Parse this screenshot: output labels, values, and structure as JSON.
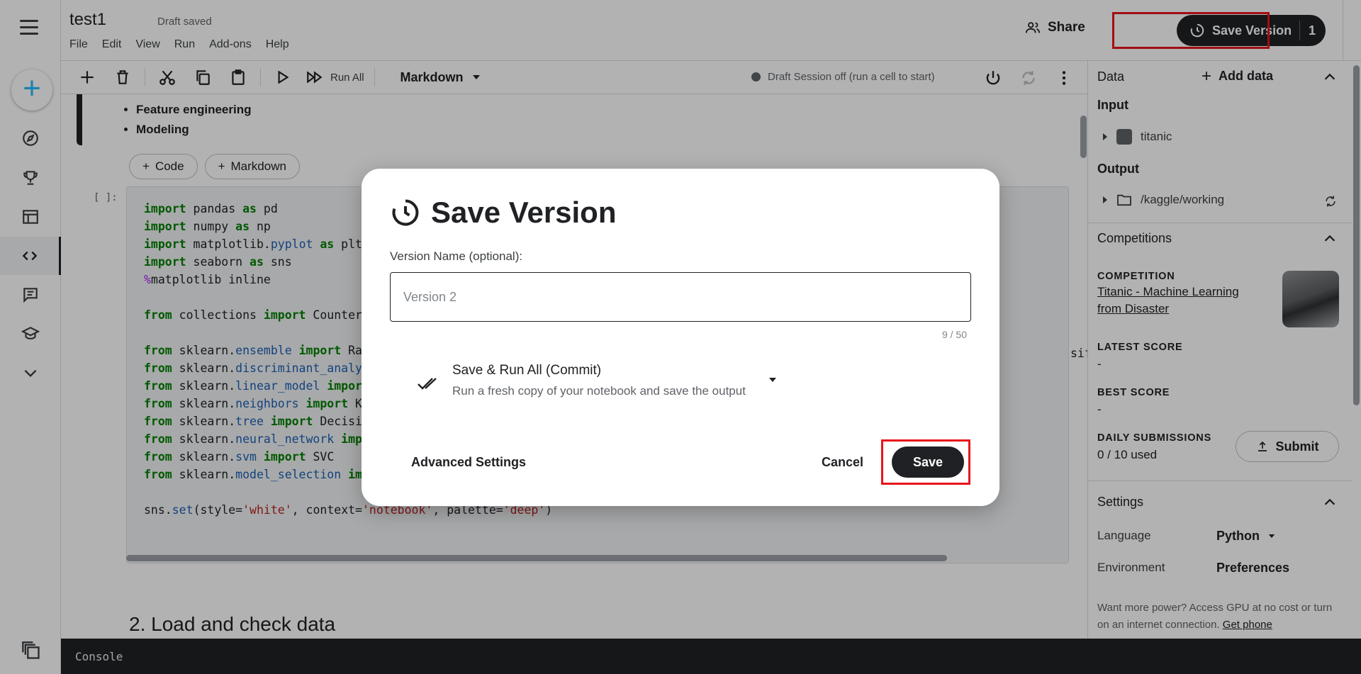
{
  "notebook": {
    "title": "test1",
    "status": "Draft saved"
  },
  "menubar": [
    "File",
    "Edit",
    "View",
    "Run",
    "Add-ons",
    "Help"
  ],
  "header": {
    "share_label": "Share",
    "save_version_label": "Save Version",
    "save_version_count": "1"
  },
  "toolbar": {
    "run_all_label": "Run All",
    "cell_type": "Markdown",
    "session_status": "Draft Session off (run a cell to start)"
  },
  "content": {
    "bullets": [
      "Feature engineering",
      "Modeling"
    ],
    "add_code_label": "Code",
    "add_markdown_label": "Markdown",
    "prompt": "[ ]:",
    "code_overflow_text": "sifier, V",
    "section_heading": "2. Load and check data"
  },
  "right_panel": {
    "data_header": "Data",
    "add_data_label": "Add data",
    "input_label": "Input",
    "input_item": "titanic",
    "output_label": "Output",
    "output_item": "/kaggle/working",
    "competitions_header": "Competitions",
    "competition_caption": "COMPETITION",
    "competition_name_line1": "Titanic - Machine Learning",
    "competition_name_line2": "from Disaster",
    "latest_score_caption": "LATEST SCORE",
    "latest_score_value": "-",
    "best_score_caption": "BEST SCORE",
    "best_score_value": "-",
    "daily_submissions_caption": "DAILY SUBMISSIONS",
    "daily_submissions_value": "0 / 10 used",
    "submit_label": "Submit",
    "settings_header": "Settings",
    "language_label": "Language",
    "language_value": "Python",
    "environment_label": "Environment",
    "environment_value": "Preferences",
    "power_note": "Want more power? Access GPU at no cost or turn on an internet connection.",
    "power_link": "Get phone"
  },
  "console": {
    "label": "Console"
  },
  "modal": {
    "title": "Save Version",
    "version_name_label": "Version Name (optional):",
    "version_name_placeholder": "Version 2",
    "counter": "9 / 50",
    "option_title": "Save & Run All (Commit)",
    "option_subtitle": "Run a fresh copy of your notebook and save the output",
    "advanced_label": "Advanced Settings",
    "cancel_label": "Cancel",
    "save_label": "Save"
  },
  "icons": {
    "rail": [
      "menu-icon",
      "create-icon",
      "compass-icon",
      "trophy-icon",
      "table-icon",
      "code-icon",
      "comment-icon",
      "school-icon",
      "chevron-down-icon"
    ],
    "highlight_color": "#e8151b",
    "brand_color": "#20beff"
  }
}
